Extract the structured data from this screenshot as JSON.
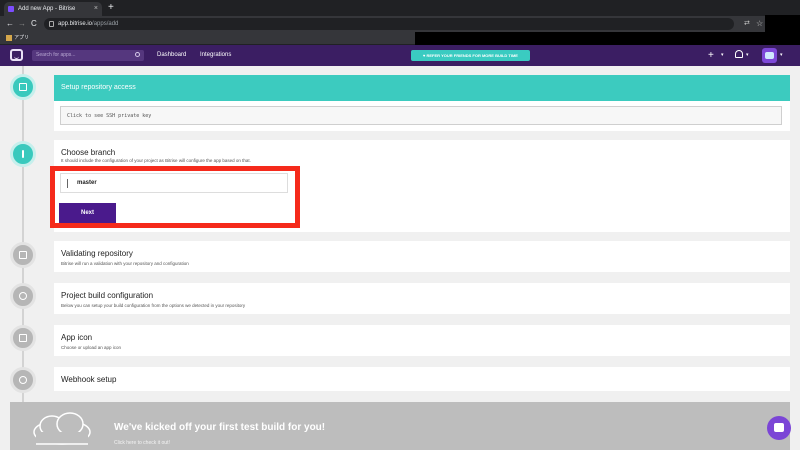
{
  "browser": {
    "tab_title": "Add new App - Bitrise",
    "tab_close": "×",
    "new_tab": "+",
    "back": "←",
    "forward": "→",
    "reload": "C",
    "url_host": "app.bitrise.io",
    "url_path": "/apps/add",
    "bookmark": "アプリ"
  },
  "header": {
    "search_placeholder": "Search for apps...",
    "nav": [
      "Dashboard",
      "Integrations"
    ],
    "refer_text": "♥ REFER YOUR FRIENDS FOR MORE BUILD TIME",
    "add_icon": "+",
    "caret": "▾"
  },
  "steps": {
    "ssh": {
      "title": "Setup repository access",
      "ssh_link": "Click to see SSH private key"
    },
    "branch": {
      "title": "Choose branch",
      "subtitle": "It should include the configuration of your project as Bitrise will configure the app based on that.",
      "value": "master",
      "next_label": "Next"
    },
    "validating": {
      "title": "Validating repository",
      "subtitle": "Bitrise will run a validation with your repository and configuration"
    },
    "build_config": {
      "title": "Project build configuration",
      "subtitle": "Below you can setup your build configuration from the options we detected in your repository"
    },
    "app_icon": {
      "title": "App icon",
      "subtitle": "Choose or upload an app icon"
    },
    "webhook": {
      "title": "Webhook setup"
    }
  },
  "banner": {
    "title": "We've kicked off your first test build for you!",
    "link": "Click here to check it out!"
  },
  "colors": {
    "teal": "#3ccbbf",
    "purple": "#3b1e63",
    "button": "#4a1a8c",
    "highlight": "#f52a1b"
  },
  "icons": [
    "lock-icon",
    "branch-icon",
    "validate-icon",
    "gear-icon",
    "app-icon-icon",
    "anchor-icon",
    "chat-icon"
  ]
}
